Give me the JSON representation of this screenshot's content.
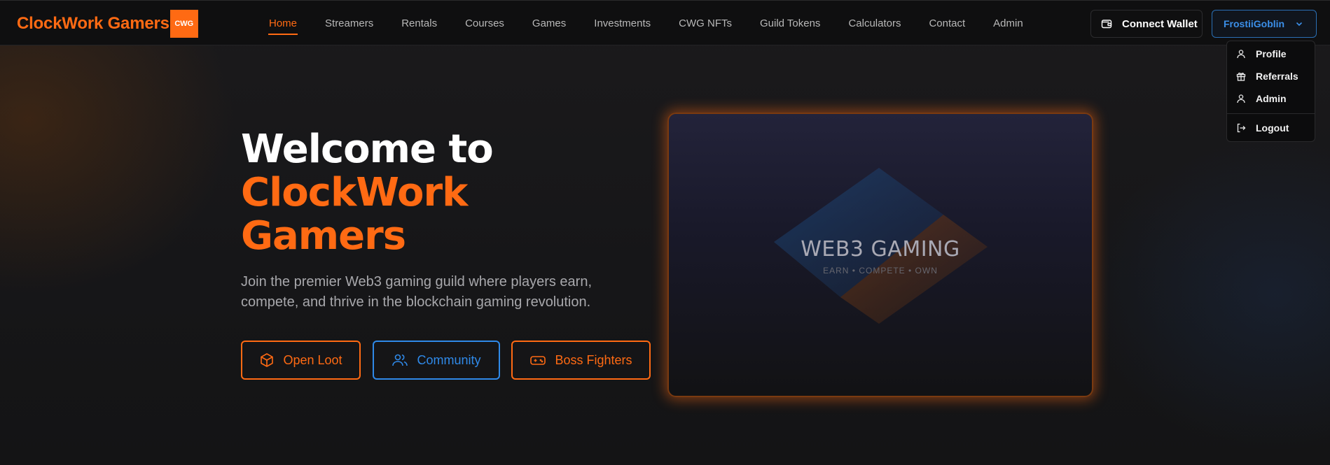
{
  "brand": {
    "name": "ClockWork Gamers",
    "badge": "CWG"
  },
  "nav": {
    "items": [
      {
        "label": "Home",
        "active": true
      },
      {
        "label": "Streamers"
      },
      {
        "label": "Rentals"
      },
      {
        "label": "Courses"
      },
      {
        "label": "Games"
      },
      {
        "label": "Investments"
      },
      {
        "label": "CWG NFTs"
      },
      {
        "label": "Guild Tokens"
      },
      {
        "label": "Calculators"
      },
      {
        "label": "Contact"
      },
      {
        "label": "Admin"
      }
    ]
  },
  "header": {
    "connect_wallet_label": "Connect Wallet",
    "user_name": "FrostiiGoblin"
  },
  "user_menu": {
    "items": [
      {
        "label": "Profile",
        "icon": "user-icon"
      },
      {
        "label": "Referrals",
        "icon": "gift-icon"
      },
      {
        "label": "Admin",
        "icon": "user-icon"
      },
      {
        "label": "Logout",
        "icon": "logout-icon"
      }
    ]
  },
  "hero": {
    "title_line1": "Welcome to",
    "title_line2": "ClockWork",
    "title_line3": "Gamers",
    "subtitle_line1": "Join the premier Web3 gaming guild where players earn,",
    "subtitle_line2": "compete, and thrive in the blockchain gaming revolution.",
    "buttons": [
      {
        "label": "Open Loot",
        "icon": "cube-icon",
        "color": "#ff6a13"
      },
      {
        "label": "Community",
        "icon": "users-icon",
        "color": "#2f89e8"
      },
      {
        "label": "Boss Fighters",
        "icon": "gamepad-icon",
        "color": "#ff6a13"
      }
    ]
  },
  "showcase": {
    "title": "WEB3 GAMING",
    "tagline": "EARN • COMPETE • OWN"
  },
  "colors": {
    "accent": "#ff6a13",
    "link_blue": "#2f89e8",
    "background": "#141416"
  }
}
